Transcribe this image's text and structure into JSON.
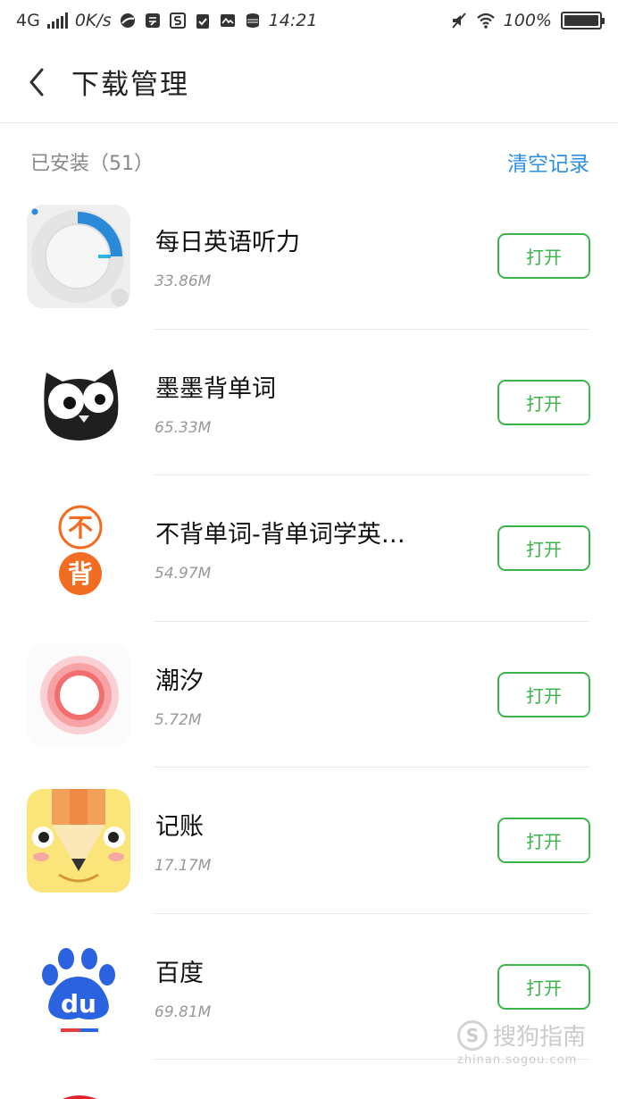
{
  "status_bar": {
    "network": "4G",
    "speed": "0K/s",
    "time": "14:21",
    "battery": "100%",
    "battery_level": 1.0
  },
  "header": {
    "title": "下载管理"
  },
  "section": {
    "installed_label": "已安装（51）",
    "clear_label": "清空记录"
  },
  "apps": [
    {
      "name": "每日英语听力",
      "size": "33.86M",
      "button": "打开",
      "icon": "meiri-yingyu-icon"
    },
    {
      "name": "墨墨背单词",
      "size": "65.33M",
      "button": "打开",
      "icon": "momo-owl-icon"
    },
    {
      "name": "不背单词-背单词学英…",
      "size": "54.97M",
      "button": "打开",
      "icon": "bubei-icon"
    },
    {
      "name": "潮汐",
      "size": "5.72M",
      "button": "打开",
      "icon": "chaoxi-ring-icon"
    },
    {
      "name": "记账",
      "size": "17.17M",
      "button": "打开",
      "icon": "jizhang-pencil-icon"
    },
    {
      "name": "百度",
      "size": "69.81M",
      "button": "打开",
      "icon": "baidu-paw-icon"
    }
  ],
  "watermark": {
    "text": "搜狗指南",
    "sub": "zhinan.sogou.com",
    "logo_letter": "S"
  },
  "colors": {
    "accent_green": "#39b54a",
    "link_blue": "#2d8fe0"
  }
}
